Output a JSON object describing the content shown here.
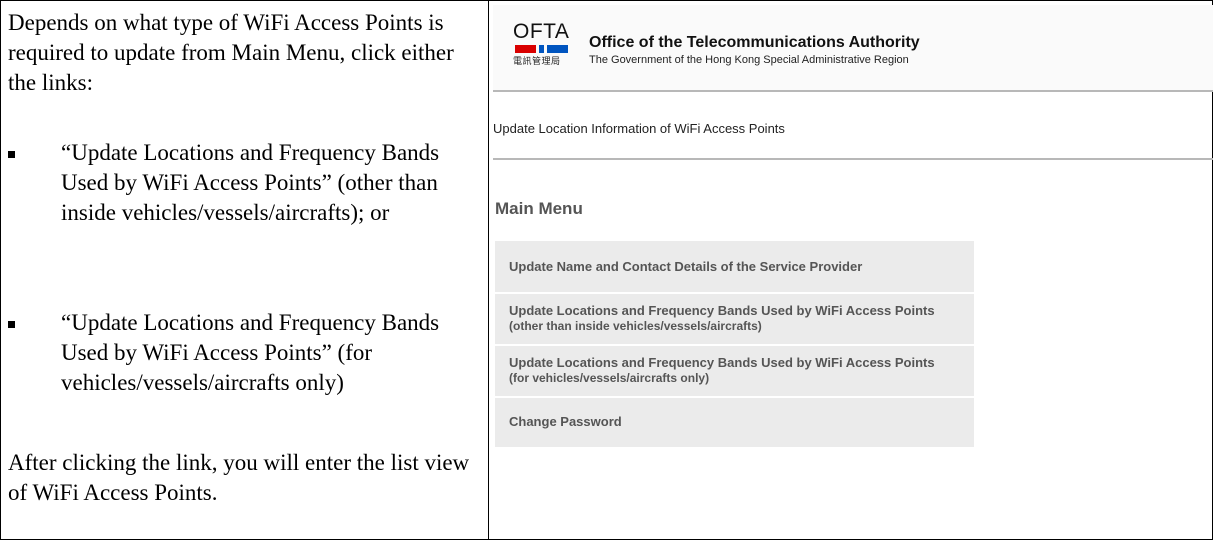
{
  "instructions": {
    "intro": "Depends on what type of WiFi Access Points is required to update from Main Menu, click either the links:",
    "bullets": [
      "“Update Locations and Frequency Bands Used by WiFi Access Points” (other than inside vehicles/vessels/aircrafts); or",
      "“Update Locations and Frequency Bands Used by WiFi Access Points” (for vehicles/vessels/aircrafts only)"
    ],
    "outro": "After clicking the link, you will enter the list view of WiFi Access Points."
  },
  "header": {
    "logo_text": "OFTA",
    "logo_chinese": "電訊管理局",
    "org_name": "Office of the Telecommunications Authority",
    "org_subtitle": "The Government of the Hong Kong Special Administrative Region",
    "colors": {
      "red": "#d90000",
      "blue": "#0055c0"
    }
  },
  "page": {
    "subtitle": "Update Location Information of WiFi Access Points",
    "menu_title": "Main Menu"
  },
  "menu": {
    "items": [
      {
        "line1": "Update Name and Contact Details of the Service Provider",
        "line2": ""
      },
      {
        "line1": "Update Locations and Frequency Bands Used by WiFi Access Points",
        "line2": "(other than inside vehicles/vessels/aircrafts)"
      },
      {
        "line1": "Update Locations and Frequency Bands Used by WiFi Access Points",
        "line2": "(for vehicles/vessels/aircrafts only)"
      },
      {
        "line1": "Change Password",
        "line2": ""
      }
    ]
  }
}
